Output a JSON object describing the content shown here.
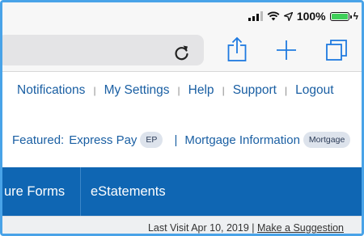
{
  "status": {
    "battery_text": "100%",
    "battery_level": 1.0,
    "battery_color": "#3fd05a"
  },
  "browser": {
    "icons": [
      "reload-icon",
      "share-icon",
      "new-tab-plus-icon",
      "tabs-icon"
    ]
  },
  "top_links": [
    "Notifications",
    "My Settings",
    "Help",
    "Support",
    "Logout"
  ],
  "top_separator": "|",
  "featured": {
    "label": "Featured:",
    "item1_text": "Express Pay",
    "item1_badge": "EP",
    "separator": "|",
    "item2_text": "Mortgage Information",
    "item2_badge": "Mortgage"
  },
  "nav": {
    "item_a": "ure Forms",
    "item_b": "eStatements",
    "bg_color": "#0f66b3"
  },
  "info": {
    "last_visit": "Last Visit Apr 10, 2019 | ",
    "suggestion_link": "Make a Suggestion"
  }
}
